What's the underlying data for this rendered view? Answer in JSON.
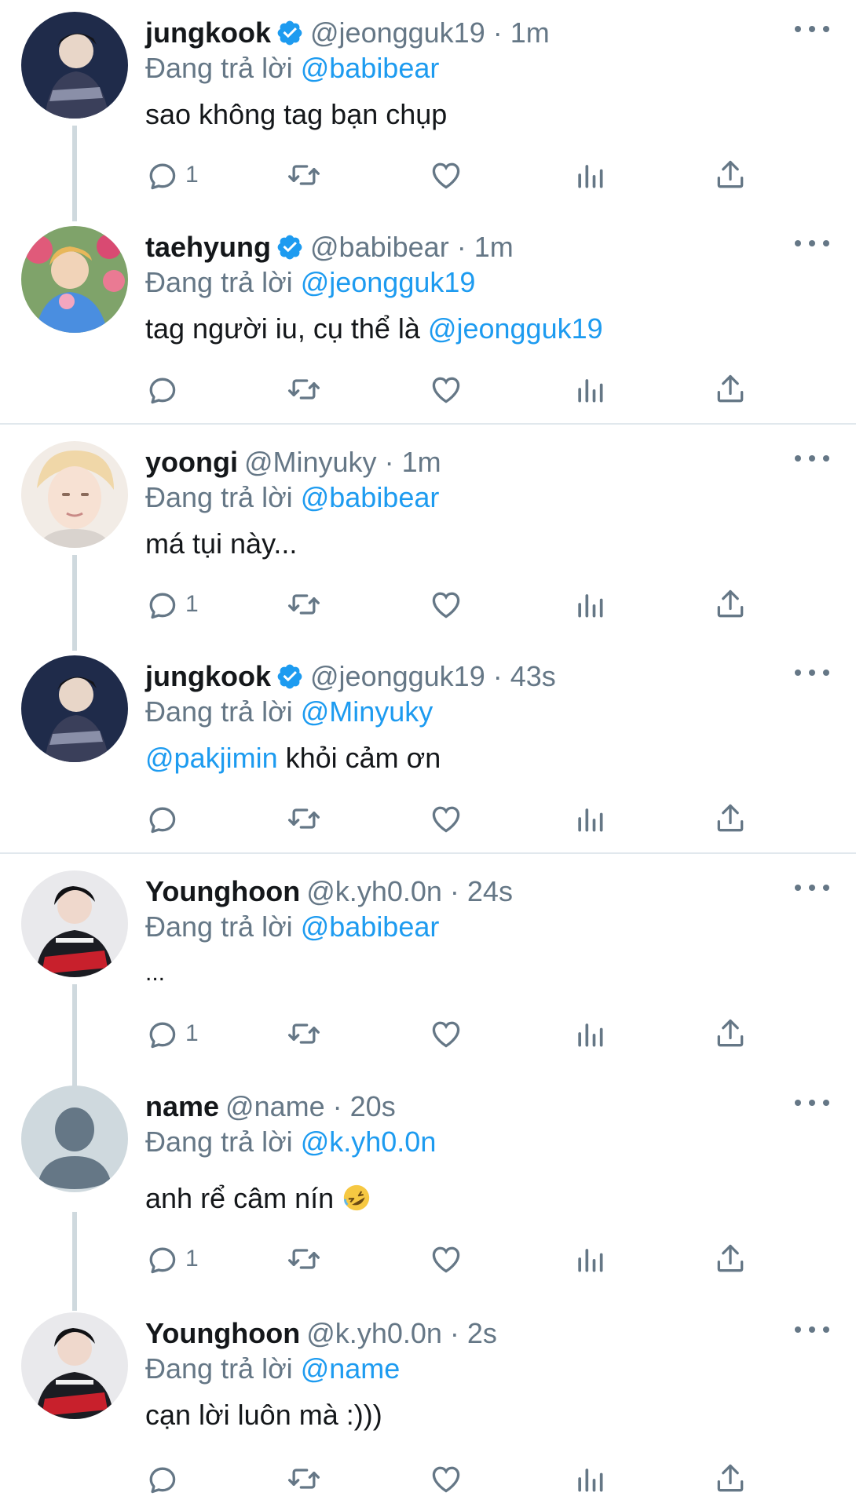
{
  "reply_prefix": "Đang trả lời",
  "tweets": [
    {
      "name": "jungkook",
      "verified": true,
      "handle": "@jeongguk19",
      "time": "1m",
      "reply_to": "@babibear",
      "body_parts": [
        {
          "text": "sao không tag bạn chụp",
          "link": false
        }
      ],
      "reply_count": "1"
    },
    {
      "name": "taehyung",
      "verified": true,
      "handle": "@babibear",
      "time": "1m",
      "reply_to": "@jeongguk19",
      "body_parts": [
        {
          "text": "tag người iu, cụ thể là ",
          "link": false
        },
        {
          "text": "@jeongguk19",
          "link": true
        }
      ],
      "reply_count": ""
    },
    {
      "name": "yoongi",
      "verified": false,
      "handle": "@Minyuky",
      "time": "1m",
      "reply_to": "@babibear",
      "body_parts": [
        {
          "text": "má tụi này...",
          "link": false
        }
      ],
      "reply_count": "1"
    },
    {
      "name": "jungkook",
      "verified": true,
      "handle": "@jeongguk19",
      "time": "43s",
      "reply_to": "@Minyuky",
      "body_parts": [
        {
          "text": "@pakjimin",
          "link": true
        },
        {
          "text": " khỏi cảm ơn",
          "link": false
        }
      ],
      "reply_count": ""
    },
    {
      "name": "Younghoon",
      "verified": false,
      "handle": "@k.yh0.0n",
      "time": "24s",
      "reply_to": "@babibear",
      "body_parts": [
        {
          "text": "...",
          "link": false
        }
      ],
      "reply_count": "1"
    },
    {
      "name": "name",
      "verified": false,
      "handle": "@name",
      "time": "20s",
      "reply_to": "@k.yh0.0n",
      "body_parts": [
        {
          "text": "anh rể câm nín ",
          "link": false
        }
      ],
      "emoji": "rolling-on-floor-laughing-emoji",
      "reply_count": "1"
    },
    {
      "name": "Younghoon",
      "verified": false,
      "handle": "@k.yh0.0n",
      "time": "2s",
      "reply_to": "@name",
      "body_parts": [
        {
          "text": "cạn lời luôn mà :)))",
          "link": false
        }
      ],
      "reply_count": ""
    }
  ],
  "colors": {
    "link": "#1d9bf0",
    "muted": "#657786",
    "verified": "#1d9bf0",
    "divider": "#e1e8ed"
  },
  "icons": [
    "more-icon",
    "verified-badge-icon",
    "reply-icon",
    "retweet-icon",
    "like-icon",
    "stats-icon",
    "share-icon"
  ]
}
